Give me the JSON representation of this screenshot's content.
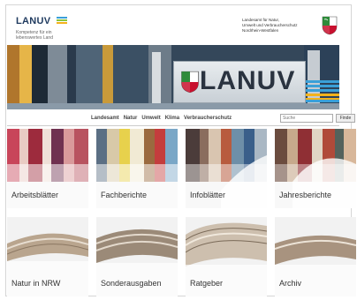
{
  "header": {
    "logo_text": "LANUV",
    "logo_tagline": "Kompetenz für ein lebenswertes Land",
    "agency_lines": [
      "Landesamt für Natur,",
      "Umwelt und Verbraucherschutz",
      "Nordrhein-Westfalen"
    ],
    "crest_icon": "nrw-crest-icon"
  },
  "hero": {
    "sign_text": "LANUV"
  },
  "nav": {
    "items": [
      {
        "label": "Landesamt"
      },
      {
        "label": "Natur"
      },
      {
        "label": "Umwelt"
      },
      {
        "label": "Klima"
      },
      {
        "label": "Verbraucherschutz"
      }
    ],
    "search_placeholder": "Suche",
    "search_button": "Finde"
  },
  "tiles": [
    {
      "label": "Arbeitsblätter"
    },
    {
      "label": "Fachberichte"
    },
    {
      "label": "Infoblätter"
    },
    {
      "label": "Jahresberichte"
    },
    {
      "label": "Natur in NRW"
    },
    {
      "label": "Sonderausgaben"
    },
    {
      "label": "Ratgeber"
    },
    {
      "label": "Archiv"
    }
  ],
  "colors": {
    "brand_blue": "#1f3a5f",
    "logo_stripes": [
      "#3aa0d8",
      "#8cc63f",
      "#f3b21b"
    ]
  }
}
